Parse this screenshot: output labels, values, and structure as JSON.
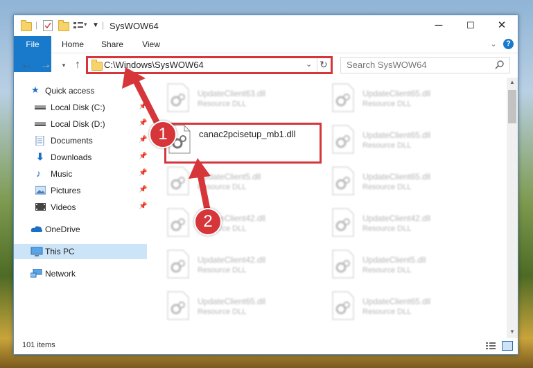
{
  "window": {
    "title": "SysWOW64",
    "controls": {
      "minimize": "─",
      "maximize": "☐",
      "close": "✕"
    }
  },
  "ribbon": {
    "tabs": [
      "File",
      "Home",
      "Share",
      "View"
    ],
    "collapse_icon": "chevron-down-icon",
    "help_label": "?"
  },
  "address_bar": {
    "path": "C:\\Windows\\SysWOW64",
    "search_placeholder": "Search SysWOW64"
  },
  "sidebar": {
    "items": [
      {
        "label": "Quick access",
        "icon": "star-icon",
        "pinned": false
      },
      {
        "label": "Local Disk (C:)",
        "icon": "drive-icon",
        "pinned": true
      },
      {
        "label": "Local Disk (D:)",
        "icon": "drive-icon",
        "pinned": true
      },
      {
        "label": "Documents",
        "icon": "documents-icon",
        "pinned": true
      },
      {
        "label": "Downloads",
        "icon": "download-icon",
        "pinned": true
      },
      {
        "label": "Music",
        "icon": "music-icon",
        "pinned": true
      },
      {
        "label": "Pictures",
        "icon": "pictures-icon",
        "pinned": true
      },
      {
        "label": "Videos",
        "icon": "videos-icon",
        "pinned": true
      },
      {
        "label": "OneDrive",
        "icon": "cloud-icon",
        "pinned": false
      },
      {
        "label": "This PC",
        "icon": "computer-icon",
        "pinned": false,
        "selected": true
      },
      {
        "label": "Network",
        "icon": "network-icon",
        "pinned": false
      }
    ]
  },
  "files": {
    "left": [
      {
        "name": "UpdateClient63.dll",
        "type": "Resource DLL"
      },
      {
        "name": "canac2pcisetup_mb1.dll",
        "type": ""
      },
      {
        "name": "UpdateClient5.dll",
        "type": "Resource DLL"
      },
      {
        "name": "UpdateClient42.dll",
        "type": "Resource DLL"
      },
      {
        "name": "UpdateClient42.dll",
        "type": "Resource DLL"
      },
      {
        "name": "UpdateClient65.dll",
        "type": "Resource DLL"
      }
    ],
    "right": [
      {
        "name": "UpdateClient65.dll",
        "type": "Resource DLL"
      },
      {
        "name": "UpdateClient65.dll",
        "type": "Resource DLL"
      },
      {
        "name": "UpdateClient65.dll",
        "type": "Resource DLL"
      },
      {
        "name": "UpdateClient42.dll",
        "type": "Resource DLL"
      },
      {
        "name": "UpdateClient5.dll",
        "type": "Resource DLL"
      },
      {
        "name": "UpdateClient65.dll",
        "type": "Resource DLL"
      }
    ]
  },
  "status": {
    "item_count": "101 items"
  },
  "annotations": {
    "badge_1": "1",
    "badge_2": "2",
    "color": "#d6353a"
  }
}
